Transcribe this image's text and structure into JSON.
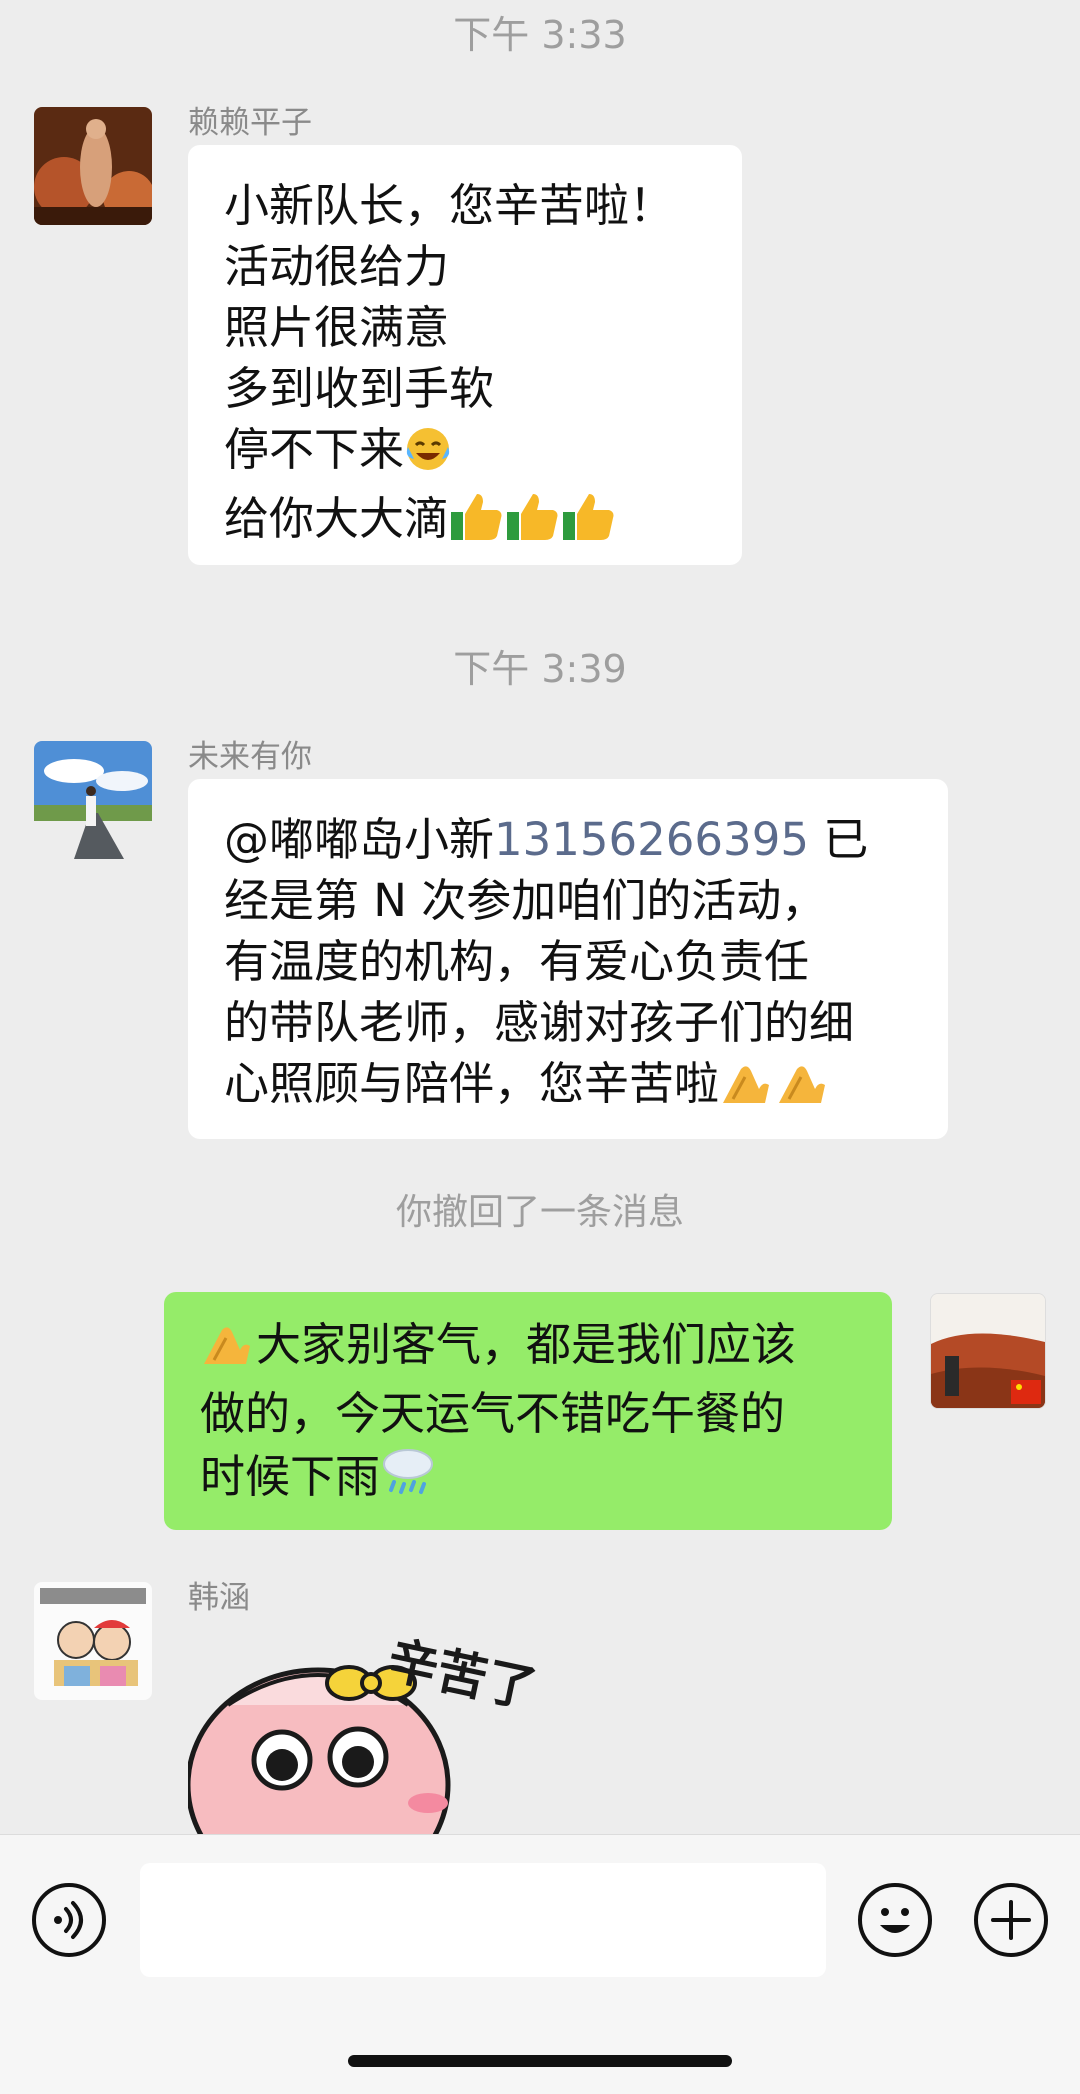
{
  "chat": {
    "timestamps": [
      "下午 3:33",
      "下午 3:39"
    ],
    "messages": [
      {
        "sender": "赖赖平子",
        "lines": [
          "小新队长，您辛苦啦！",
          "活动很给力",
          "照片很满意",
          "多到收到手软",
          "停不下来",
          "给你大大滴"
        ]
      },
      {
        "sender": "未来有你",
        "mention_name": "@嘟嘟岛小新",
        "mention_phone": "13156266395",
        "mention_tail": " 已",
        "lines": [
          "经是第 N 次参加咱们的活动，",
          "有温度的机构，有爱心负责任",
          "的带队老师，感谢对孩子们的细",
          "心照顾与陪伴，您辛苦啦"
        ]
      },
      {
        "sender": "韩涵",
        "sticker_text": "辛苦了"
      }
    ],
    "recalled_notice": "你撤回了一条消息",
    "self_message": {
      "lines": [
        "大家别客气，都是我们应该",
        "做的，今天运气不错吃午餐的",
        "时候下雨"
      ]
    }
  },
  "input_bar": {
    "placeholder": "",
    "voice_icon": "voice-icon",
    "emoji_icon": "smiley-icon",
    "add_icon": "plus-icon"
  },
  "colors": {
    "background": "#ededed",
    "bubble_other": "#ffffff",
    "bubble_self": "#95ec69",
    "mention_link": "#5b6b8c"
  }
}
